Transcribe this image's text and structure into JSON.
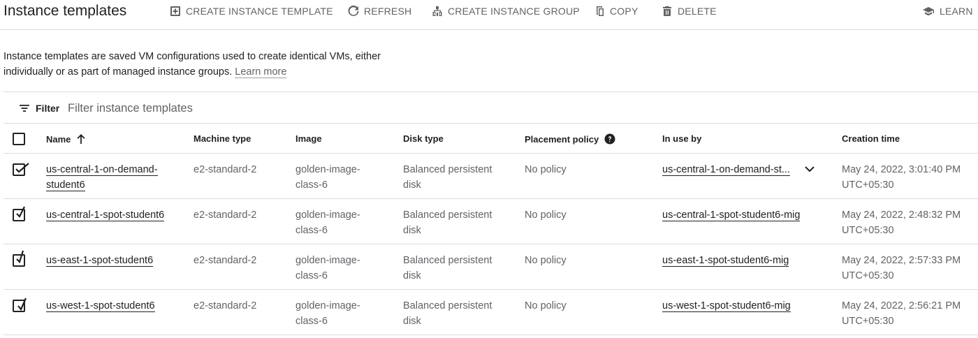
{
  "toolbar": {
    "title": "Instance templates",
    "create_template": "CREATE INSTANCE TEMPLATE",
    "refresh": "REFRESH",
    "create_group": "CREATE INSTANCE GROUP",
    "copy": "COPY",
    "delete": "DELETE",
    "learn": "LEARN"
  },
  "intro": {
    "line1": "Instance templates are saved VM configurations used to create identical VMs, either",
    "line2": "individually or as part of managed instance groups.",
    "learn_more": "Learn more"
  },
  "filter": {
    "label": "Filter",
    "placeholder": "Filter instance templates"
  },
  "columns": {
    "name": "Name",
    "machine_type": "Machine type",
    "image": "Image",
    "disk_type": "Disk type",
    "placement_policy": "Placement policy",
    "in_use_by": "In use by",
    "creation_time": "Creation time"
  },
  "rows": [
    {
      "checked": true,
      "name1": "us-central-1-on-demand-",
      "name2": "student6",
      "machine_type": "e2-standard-2",
      "image1": "golden-image-",
      "image2": "class-6",
      "disk1": "Balanced persistent",
      "disk2": "disk",
      "policy": "No policy",
      "in_use_by": "us-central-1-on-demand-st...",
      "time1": "May 24, 2022, 3:01:40 PM",
      "time2": "UTC+05:30"
    },
    {
      "checked": true,
      "name1": "us-central-1-spot-student6",
      "name2": "",
      "machine_type": "e2-standard-2",
      "image1": "golden-image-",
      "image2": "class-6",
      "disk1": "Balanced persistent",
      "disk2": "disk",
      "policy": "No policy",
      "in_use_by": "us-central-1-spot-student6-mig",
      "time1": "May 24, 2022, 2:48:32 PM",
      "time2": "UTC+05:30"
    },
    {
      "checked": true,
      "name1": "us-east-1-spot-student6",
      "name2": "",
      "machine_type": "e2-standard-2",
      "image1": "golden-image-",
      "image2": "class-6",
      "disk1": "Balanced persistent",
      "disk2": "disk",
      "policy": "No policy",
      "in_use_by": "us-east-1-spot-student6-mig",
      "time1": "May 24, 2022, 2:57:33 PM",
      "time2": "UTC+05:30"
    },
    {
      "checked": true,
      "name1": "us-west-1-spot-student6",
      "name2": "",
      "machine_type": "e2-standard-2",
      "image1": "golden-image-",
      "image2": "class-6",
      "disk1": "Balanced persistent",
      "disk2": "disk",
      "policy": "No policy",
      "in_use_by": "us-west-1-spot-student6-mig",
      "time1": "May 24, 2022, 2:56:21 PM",
      "time2": "UTC+05:30"
    }
  ]
}
